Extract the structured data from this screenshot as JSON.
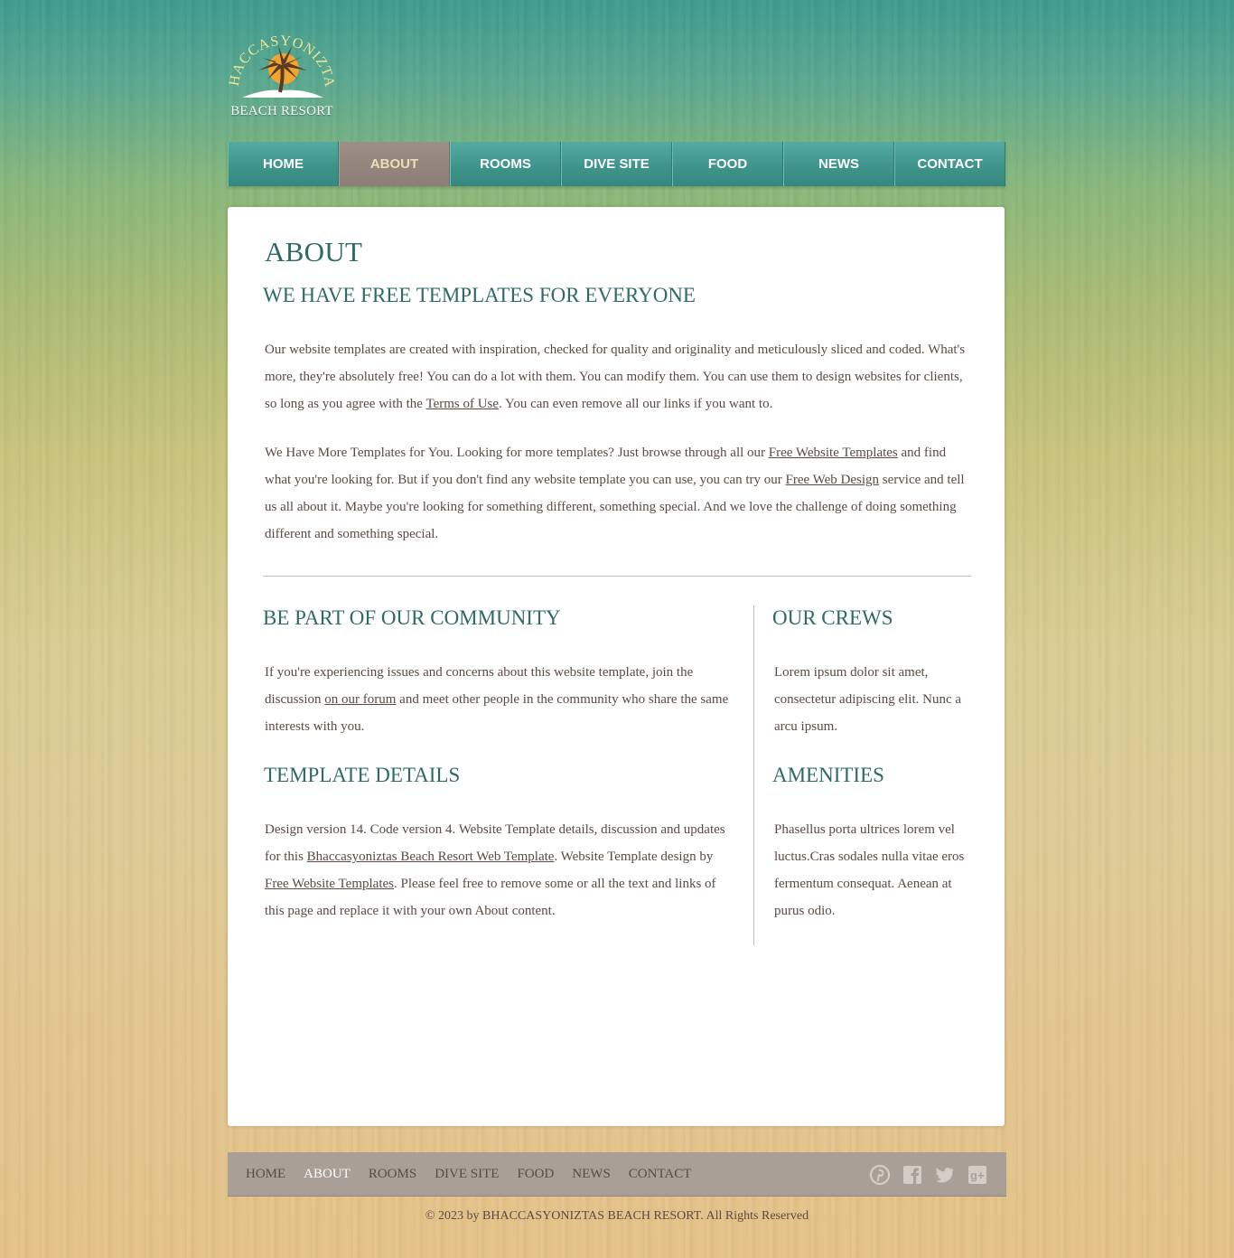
{
  "brand": {
    "name": "BHACCASYONIZTAS",
    "subtitle": "BEACH RESORT"
  },
  "nav": {
    "items": [
      {
        "label": "HOME",
        "active": false
      },
      {
        "label": "ABOUT",
        "active": true
      },
      {
        "label": "ROOMS",
        "active": false
      },
      {
        "label": "DIVE SITE",
        "active": false
      },
      {
        "label": "FOOD",
        "active": false
      },
      {
        "label": "NEWS",
        "active": false
      },
      {
        "label": "CONTACT",
        "active": false
      }
    ]
  },
  "main": {
    "title": "ABOUT",
    "subtitle": "WE HAVE FREE TEMPLATES FOR EVERYONE",
    "p1": {
      "before": "Our website templates are created with inspiration, checked for quality and originality and meticulously sliced and coded. What's more, they're absolutely free! You can do a lot with them. You can modify them. You can use them to design websites for clients, so long as you agree with the ",
      "link": "Terms of Use",
      "after": ". You can even remove all our links if you want to."
    },
    "p2": {
      "before": "We Have More Templates for You. Looking for more templates? Just browse through all our ",
      "link1": "Free Website Templates",
      "middle": " and find what you're looking for. But if you don't find any website template you can use, you can try our ",
      "link2": "Free Web Design",
      "after": " service and tell us all about it. Maybe you're looking for something different, something special. And we love the challenge of doing something different and something special."
    },
    "community": {
      "heading": "BE PART OF OUR COMMUNITY",
      "before": "If you're experiencing issues and concerns about this website template, join the discussion ",
      "link": "on our forum",
      "after": " and meet other people in the community who share the same interests with you."
    },
    "details": {
      "heading": "TEMPLATE DETAILS",
      "before": "Design version 14. Code version 4. Website Template details, discussion and updates for this ",
      "link1": "Bhaccasyoniztas Beach Resort Web Template",
      "middle": ". Website Template design by ",
      "link2": "Free Website Templates",
      "after": ". Please feel free to remove some or all the text and links of this page and replace it with your own About content."
    },
    "crews": {
      "heading": "OUR CREWS",
      "text": "Lorem ipsum dolor sit amet, consectetur adipiscing elit. Nunc a arcu ipsum."
    },
    "amenities": {
      "heading": "AMENITIES",
      "text": "Phasellus porta ultrices lorem vel luctus.Cras sodales nulla vitae eros fermentum consequat. Aenean at purus odio."
    }
  },
  "footer": {
    "links": [
      {
        "label": "HOME",
        "active": false
      },
      {
        "label": "ABOUT",
        "active": true
      },
      {
        "label": "ROOMS",
        "active": false
      },
      {
        "label": "DIVE SITE",
        "active": false
      },
      {
        "label": "FOOD",
        "active": false
      },
      {
        "label": "NEWS",
        "active": false
      },
      {
        "label": "CONTACT",
        "active": false
      }
    ],
    "social": [
      "pinterest-icon",
      "facebook-icon",
      "twitter-icon",
      "google-plus-icon"
    ],
    "copyright": "© 2023 by BHACCASYONIZTAS BEACH RESORT. All Rights Reserved"
  },
  "colors": {
    "nav_teal": "#3f958b",
    "nav_active": "#8c7e76",
    "heading": "#2f6b65",
    "text": "#5b4a44",
    "footer_bar": "#aa9f97"
  }
}
